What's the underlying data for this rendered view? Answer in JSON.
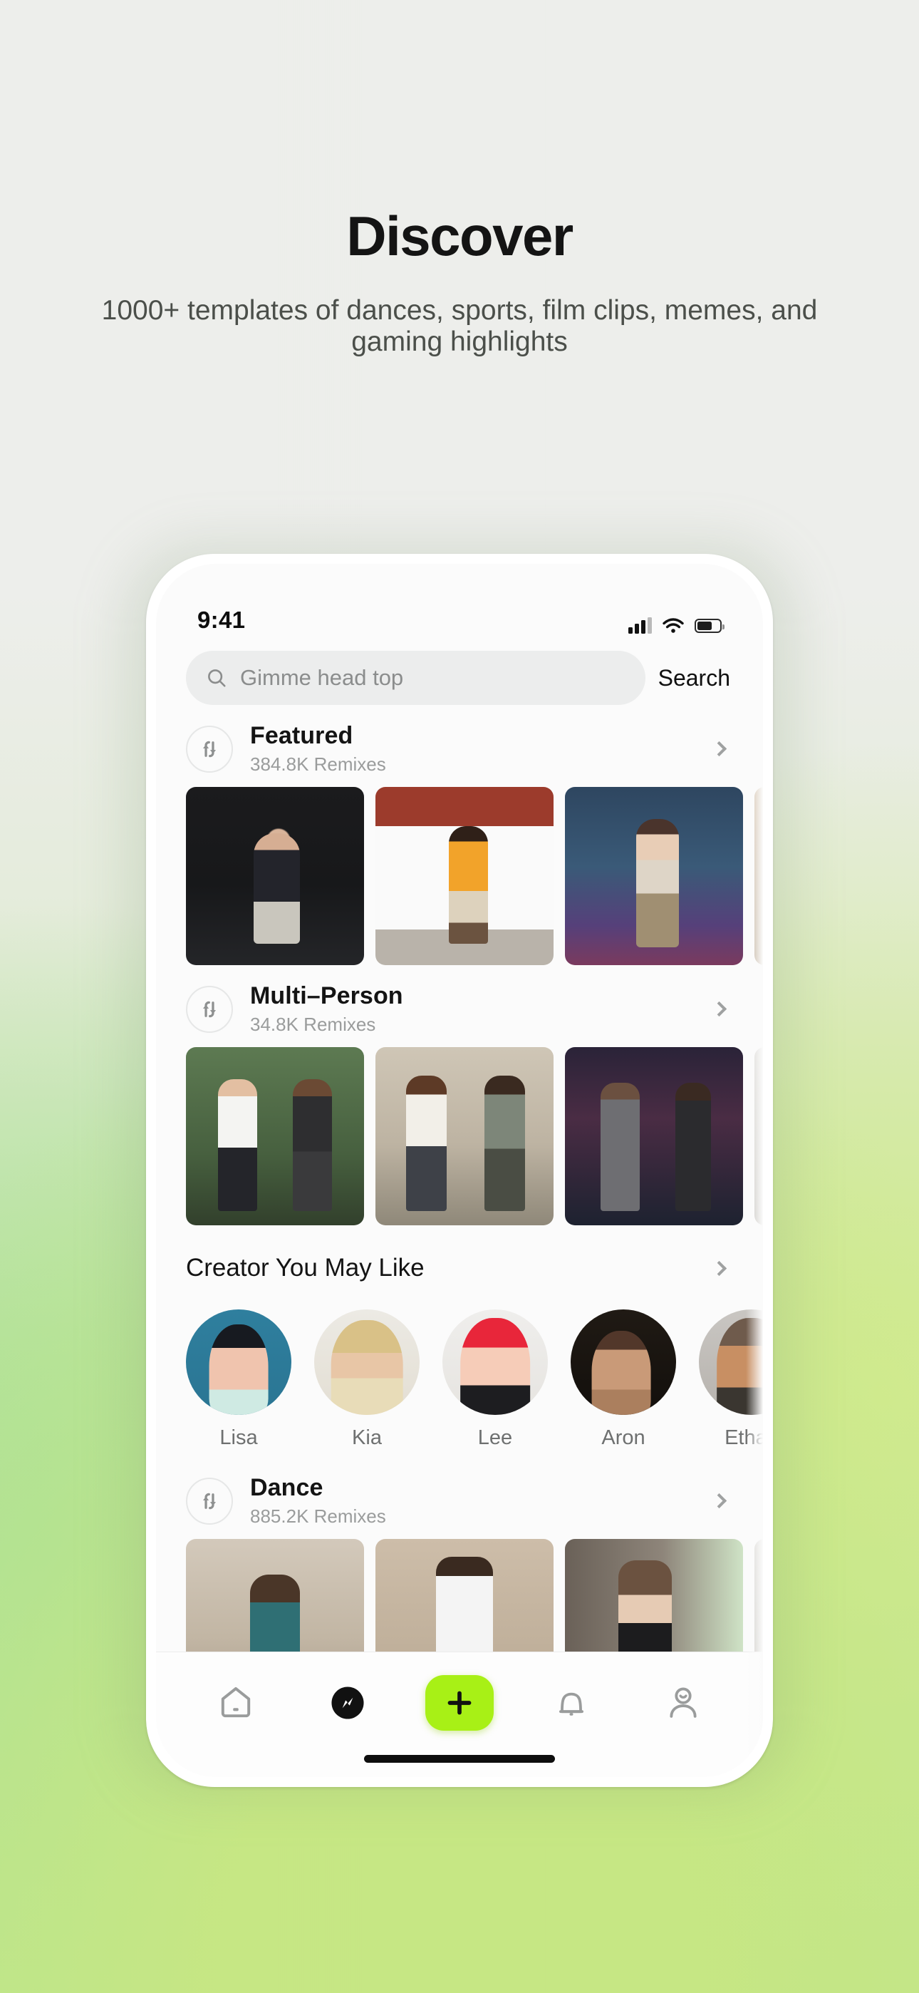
{
  "hero": {
    "title": "Discover",
    "subtitle": "1000+ templates of dances, sports, film clips, memes, and gaming highlights"
  },
  "colors": {
    "accent_green": "#A8F016",
    "bg_top": "#F0F1EE",
    "bg_bottom": "#C6EA8E",
    "text_primary": "#141414",
    "text_secondary": "#4B4F4A",
    "text_muted": "#9A9C9C"
  },
  "phone": {
    "statusbar": {
      "time": "9:41",
      "cellular_icon": "signal-bars-icon",
      "wifi_icon": "wifi-icon",
      "battery_icon": "battery-icon"
    },
    "search": {
      "placeholder": "Gimme head top",
      "value": "",
      "icon": "search-icon",
      "button_label": "Search"
    },
    "sections": [
      {
        "id": "featured",
        "icon": "remix-swap-icon",
        "title": "Featured",
        "subtitle": "384.8K Remixes",
        "chevron": "chevron-right-icon",
        "cards": [
          "t-gym",
          "t-garage",
          "t-city",
          "t-beige"
        ]
      },
      {
        "id": "multi-person",
        "icon": "remix-swap-icon",
        "title": "Multi–Person",
        "subtitle": "34.8K Remixes",
        "chevron": "chevron-right-icon",
        "cards": [
          "t-duo1",
          "t-duo2",
          "t-car",
          "t-grey"
        ]
      }
    ],
    "creators_section": {
      "title": "Creator You May Like",
      "chevron": "chevron-right-icon",
      "creators": [
        {
          "name": "Lisa",
          "avatar": "a-lisa"
        },
        {
          "name": "Kia",
          "avatar": "a-kia"
        },
        {
          "name": "Lee",
          "avatar": "a-lee"
        },
        {
          "name": "Aron",
          "avatar": "a-aron"
        },
        {
          "name": "Ethan",
          "avatar": "a-ethan"
        }
      ]
    },
    "dance_section": {
      "id": "dance",
      "icon": "remix-swap-icon",
      "title": "Dance",
      "subtitle": "885.2K Remixes",
      "chevron": "chevron-right-icon",
      "cards": [
        "t-room",
        "t-hall",
        "t-desk",
        "t-grey"
      ]
    },
    "tabbar": {
      "items": [
        {
          "name": "home-icon",
          "active": false
        },
        {
          "name": "compass-icon",
          "active": true
        },
        {
          "name": "plus-icon",
          "active": false
        },
        {
          "name": "bell-icon",
          "active": false
        },
        {
          "name": "profile-icon",
          "active": false
        }
      ]
    }
  }
}
